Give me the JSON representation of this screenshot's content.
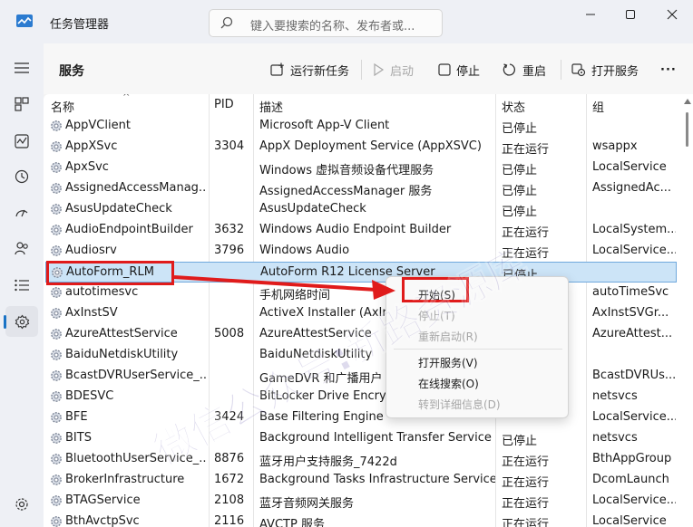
{
  "app": {
    "title": "任务管理器"
  },
  "search": {
    "placeholder": "键入要搜索的名称、发布者或..."
  },
  "nav": {
    "items": [
      {
        "id": "menu",
        "icon": "hamburger-icon"
      },
      {
        "id": "processes",
        "icon": "processes-icon"
      },
      {
        "id": "performance",
        "icon": "performance-icon"
      },
      {
        "id": "app-history",
        "icon": "history-icon"
      },
      {
        "id": "startup",
        "icon": "startup-icon"
      },
      {
        "id": "users",
        "icon": "users-icon"
      },
      {
        "id": "details",
        "icon": "details-icon"
      },
      {
        "id": "services",
        "icon": "services-icon",
        "active": true
      },
      {
        "id": "settings",
        "icon": "settings-icon"
      }
    ]
  },
  "toolbar": {
    "title": "服务",
    "run_task": "运行新任务",
    "start": "启动",
    "stop": "停止",
    "restart": "重启",
    "open_services": "打开服务",
    "more": "···"
  },
  "table": {
    "headers": {
      "name": "名称",
      "pid": "PID",
      "desc": "描述",
      "status": "状态",
      "group": "组"
    },
    "rows": [
      {
        "name": "AppVClient",
        "pid": "",
        "desc": "Microsoft App-V Client",
        "status": "已停止",
        "group": ""
      },
      {
        "name": "AppXSvc",
        "pid": "3304",
        "desc": "AppX Deployment Service (AppXSVC)",
        "status": "正在运行",
        "group": "wsappx"
      },
      {
        "name": "ApxSvc",
        "pid": "",
        "desc": "Windows 虚拟音频设备代理服务",
        "status": "已停止",
        "group": "LocalService"
      },
      {
        "name": "AssignedAccessManag...",
        "pid": "",
        "desc": "AssignedAccessManager 服务",
        "status": "已停止",
        "group": "AssignedAc..."
      },
      {
        "name": "AsusUpdateCheck",
        "pid": "",
        "desc": "AsusUpdateCheck",
        "status": "已停止",
        "group": ""
      },
      {
        "name": "AudioEndpointBuilder",
        "pid": "3632",
        "desc": "Windows Audio Endpoint Builder",
        "status": "正在运行",
        "group": "LocalSystem..."
      },
      {
        "name": "Audiosrv",
        "pid": "3796",
        "desc": "Windows Audio",
        "status": "正在运行",
        "group": "LocalService..."
      },
      {
        "name": "AutoForm_RLM",
        "pid": "",
        "desc": "AutoForm R12 License Server",
        "status": "已停止",
        "group": "",
        "selected": true
      },
      {
        "name": "autotimesvc",
        "pid": "",
        "desc": "手机网络时间",
        "status": "",
        "group": "autoTimeSvc"
      },
      {
        "name": "AxInstSV",
        "pid": "",
        "desc": "ActiveX Installer (AxIns",
        "status": "",
        "group": "AxInstSVGr..."
      },
      {
        "name": "AzureAttestService",
        "pid": "5008",
        "desc": "AzureAttestService",
        "status": "",
        "group": "AzureAttest..."
      },
      {
        "name": "BaiduNetdiskUtility",
        "pid": "",
        "desc": "BaiduNetdiskUtility",
        "status": "",
        "group": ""
      },
      {
        "name": "BcastDVRUserService_...",
        "pid": "",
        "desc": "GameDVR 和广播用户",
        "status": "",
        "group": "BcastDVRUs..."
      },
      {
        "name": "BDESVC",
        "pid": "",
        "desc": "BitLocker Drive Encryp",
        "status": "",
        "group": "netsvcs"
      },
      {
        "name": "BFE",
        "pid": "3424",
        "desc": "Base Filtering Engine",
        "status": "",
        "group": "LocalService..."
      },
      {
        "name": "BITS",
        "pid": "",
        "desc": "Background Intelligent Transfer Service",
        "status": "已停止",
        "group": "netsvcs"
      },
      {
        "name": "BluetoothUserService_...",
        "pid": "8876",
        "desc": "蓝牙用户支持服务_7422d",
        "status": "正在运行",
        "group": "BthAppGroup"
      },
      {
        "name": "BrokerInfrastructure",
        "pid": "1672",
        "desc": "Background Tasks Infrastructure Service",
        "status": "正在运行",
        "group": "DcomLaunch"
      },
      {
        "name": "BTAGService",
        "pid": "2108",
        "desc": "蓝牙音频网关服务",
        "status": "正在运行",
        "group": "LocalService..."
      },
      {
        "name": "BthAvctpSvc",
        "pid": "2116",
        "desc": "AVCTP 服务",
        "status": "正在运行",
        "group": "LocalService"
      }
    ]
  },
  "context_menu": {
    "items": [
      {
        "label": "开始(S)",
        "disabled": false
      },
      {
        "label": "停止(T)",
        "disabled": true
      },
      {
        "label": "重新启动(R)",
        "disabled": true
      },
      {
        "label": "打开服务(V)",
        "disabled": false
      },
      {
        "label": "在线搜索(O)",
        "disabled": false
      },
      {
        "label": "转到详细信息(D)",
        "disabled": true
      }
    ]
  },
  "colors": {
    "accent": "#1a73c5",
    "highlight": "#e01b1b",
    "selected_row": "#cce4f7"
  }
}
